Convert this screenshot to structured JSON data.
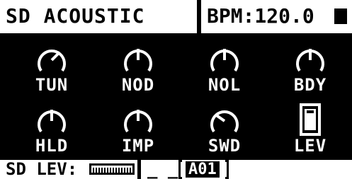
{
  "header": {
    "title": "SD ACOUSTIC",
    "bpm": "BPM:120.0"
  },
  "params": [
    {
      "label": "TUN",
      "knob_angle_deg": 45
    },
    {
      "label": "NOD",
      "knob_angle_deg": 0
    },
    {
      "label": "NOL",
      "knob_angle_deg": 0
    },
    {
      "label": "BDY",
      "knob_angle_deg": 0
    },
    {
      "label": "HLD",
      "knob_angle_deg": 0
    },
    {
      "label": "IMP",
      "knob_angle_deg": 0
    },
    {
      "label": "SWD",
      "knob_angle_deg": -55
    },
    {
      "label": "LEV",
      "level": 1.0
    }
  ],
  "footer": {
    "param_label": "SD LEV:",
    "separator": "_ _ :",
    "pattern": "A01"
  }
}
